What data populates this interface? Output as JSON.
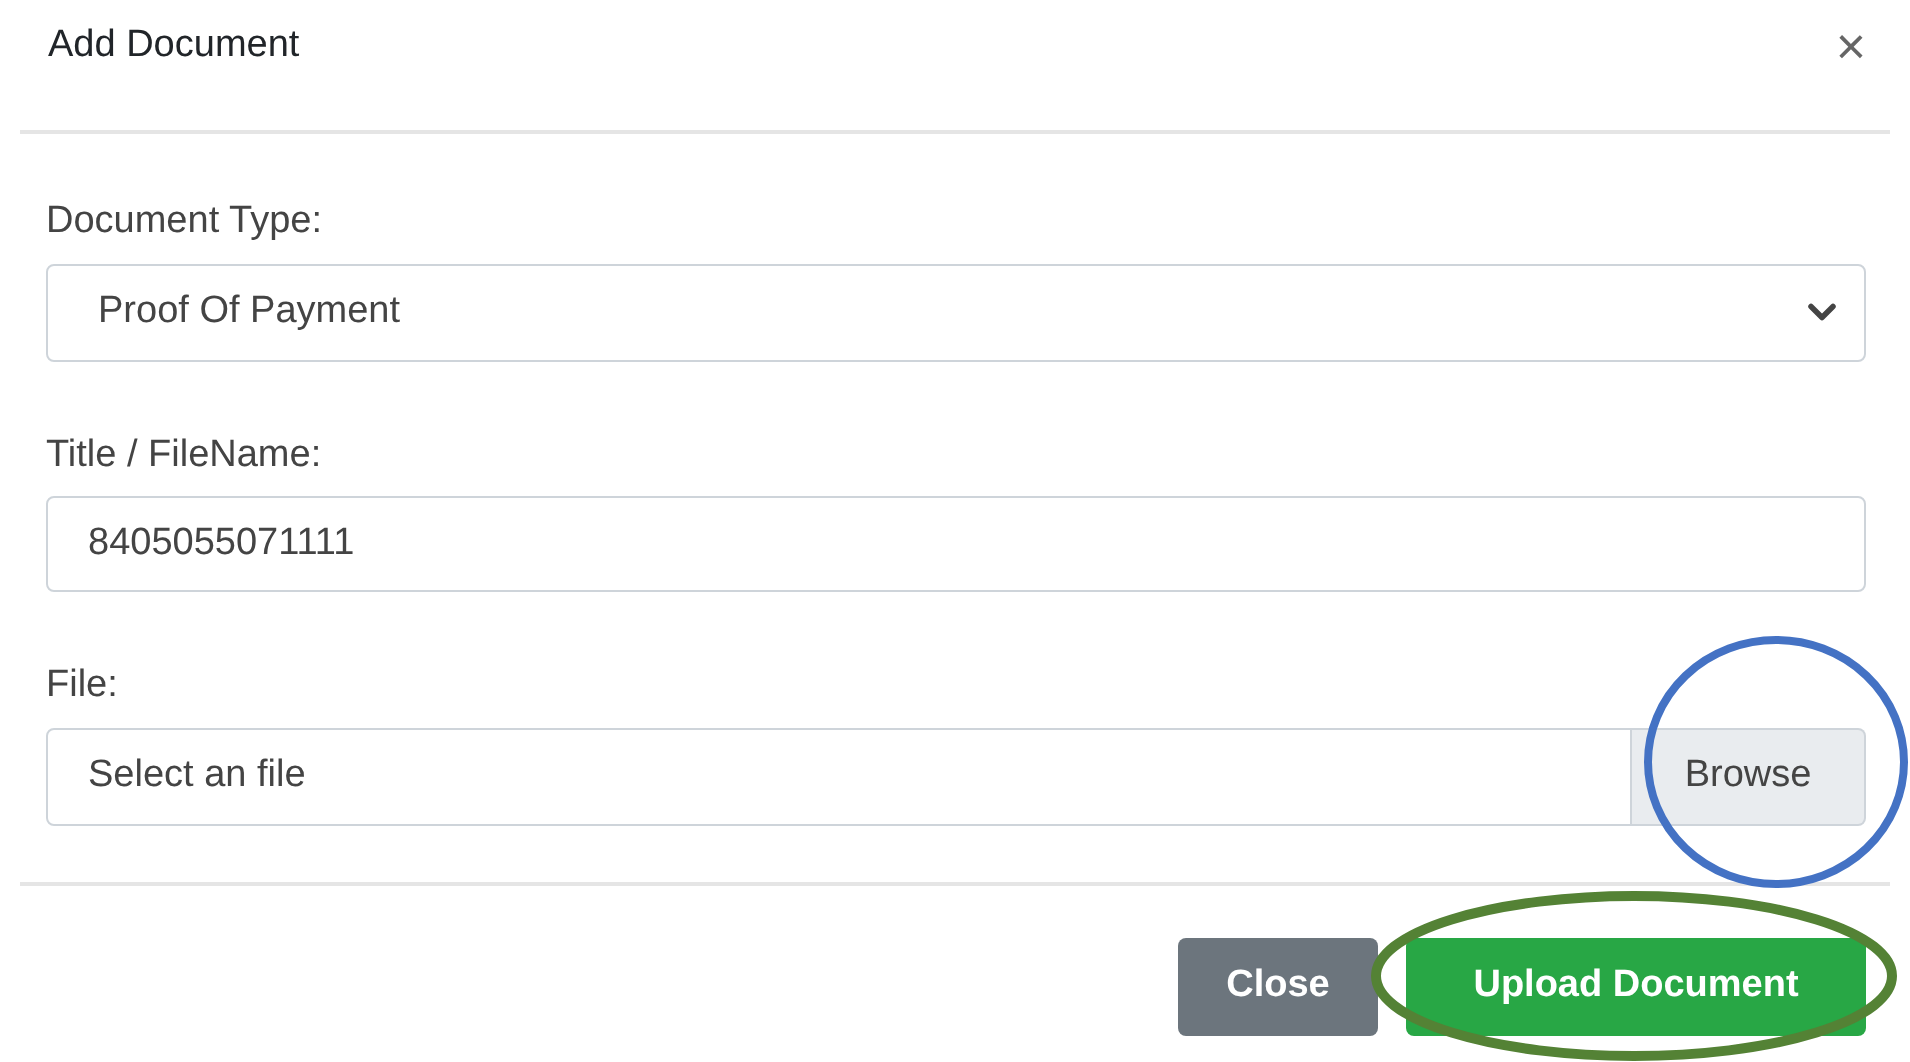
{
  "dialog": {
    "title": "Add Document",
    "close_icon": "×"
  },
  "fields": [
    {
      "kind": "select",
      "label": "Document Type:",
      "value": "Proof Of Payment"
    },
    {
      "kind": "text",
      "label": "Title / FileName:",
      "value": "8405055071111"
    },
    {
      "kind": "file",
      "label": "File:",
      "placeholder": "Select an file",
      "button": "Browse"
    }
  ],
  "buttons": [
    {
      "label": "Close",
      "kind": "secondary"
    },
    {
      "label": "Upload Document",
      "kind": "primary"
    }
  ]
}
